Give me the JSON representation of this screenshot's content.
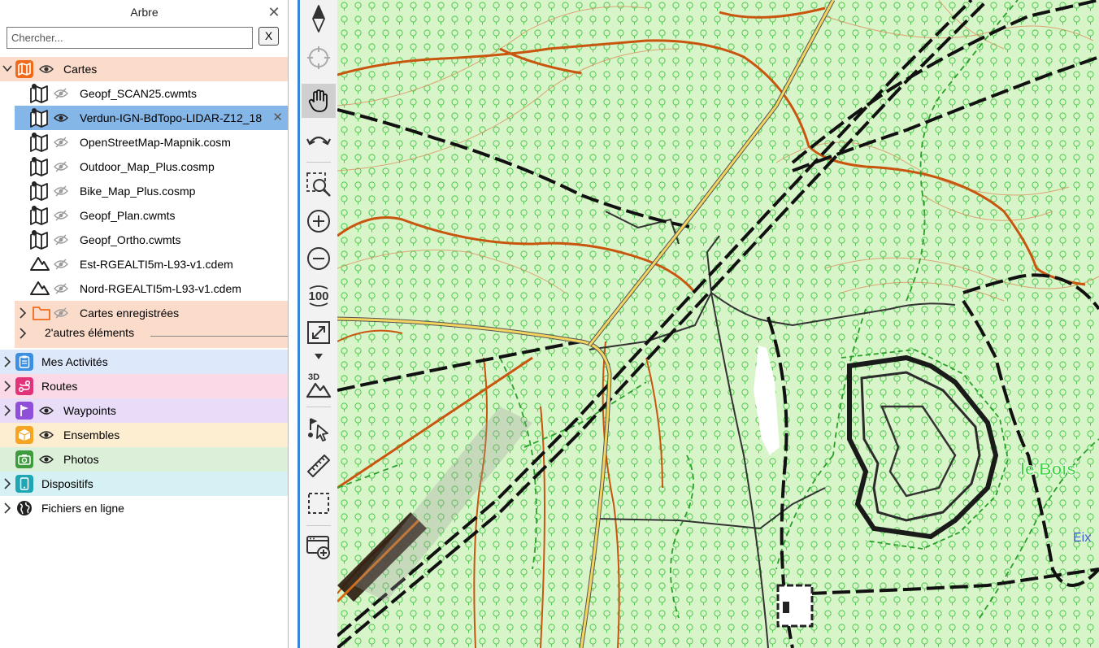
{
  "panel": {
    "title": "Arbre",
    "search_placeholder": "Chercher...",
    "clear_label": "X"
  },
  "cartes": {
    "label": "Cartes",
    "items": [
      {
        "label": "Geopf_SCAN25.cwmts",
        "icon": "map-icon",
        "selected": false
      },
      {
        "label": "Verdun-IGN-BdTopo-LIDAR-Z12_18",
        "icon": "map-icon",
        "selected": true
      },
      {
        "label": "OpenStreetMap-Mapnik.cosm",
        "icon": "map-icon",
        "selected": false
      },
      {
        "label": "Outdoor_Map_Plus.cosmp",
        "icon": "map-icon",
        "selected": false
      },
      {
        "label": "Bike_Map_Plus.cosmp",
        "icon": "map-icon",
        "selected": false
      },
      {
        "label": "Geopf_Plan.cwmts",
        "icon": "map-icon",
        "selected": false
      },
      {
        "label": "Geopf_Ortho.cwmts",
        "icon": "map-icon",
        "selected": false
      },
      {
        "label": "Est-RGEALTI5m-L93-v1.cdem",
        "icon": "elevation-icon",
        "selected": false
      },
      {
        "label": "Nord-RGEALTI5m-L93-v1.cdem",
        "icon": "elevation-icon",
        "selected": false
      }
    ],
    "saved_label": "Cartes enregistrées",
    "others_label": "2'autres éléments"
  },
  "categories": [
    {
      "label": "Mes Activités",
      "color": "#3d8fe0",
      "bg": "#dde9fa",
      "icon": "clipboard-icon",
      "eye": false
    },
    {
      "label": "Routes",
      "color": "#e0337a",
      "bg": "#fbd9e6",
      "icon": "route-icon",
      "eye": false
    },
    {
      "label": "Waypoints",
      "color": "#8f4fd8",
      "bg": "#e8dcf8",
      "icon": "flag-icon",
      "eye": true
    },
    {
      "label": "Ensembles",
      "color": "#f4a623",
      "bg": "#fdeed2",
      "icon": "box-icon",
      "eye": true
    },
    {
      "label": "Photos",
      "color": "#3e9b3e",
      "bg": "#dcefd8",
      "icon": "camera-icon",
      "eye": true
    },
    {
      "label": "Dispositifs",
      "color": "#1fa6b5",
      "bg": "#d6f1f3",
      "icon": "device-icon",
      "eye": false
    },
    {
      "label": "Fichiers en ligne",
      "color": "#222222",
      "bg": "#ffffff",
      "icon": "globe-icon",
      "eye": false
    }
  ],
  "colors": {
    "cartes_bg": "#fbdccb",
    "selected_bg": "#85b6e8",
    "accent": "#3a86d6",
    "orange": "#f06a1a"
  },
  "toolbar": {
    "items": [
      "compass-icon",
      "locate-icon",
      "pan-hand-icon",
      "undo-icon",
      "zoom-area-icon",
      "zoom-in-icon",
      "zoom-out-icon",
      "zoom-100-icon",
      "fit-icon",
      "3d-icon",
      "route-select-icon",
      "ruler-icon",
      "select-rect-icon",
      "add-window-icon"
    ],
    "zoom_100_label": "100",
    "label_3d": "3D"
  },
  "map": {
    "labels": [
      {
        "text": "le Bois",
        "color": "#35d635"
      },
      {
        "text": "Eix",
        "color": "#3b5bd6"
      }
    ]
  }
}
